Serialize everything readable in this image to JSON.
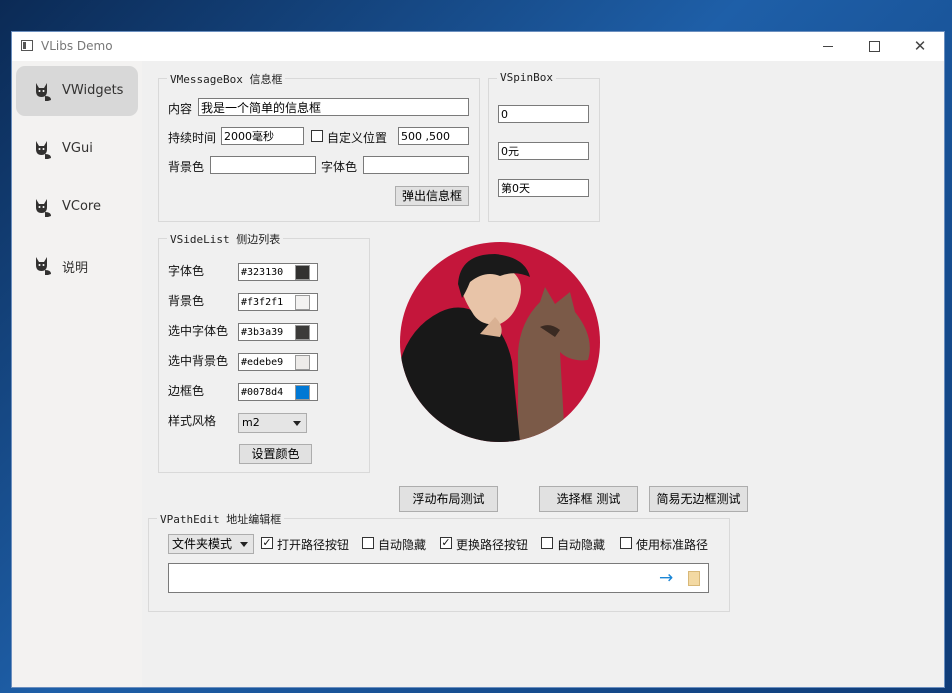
{
  "window": {
    "title": "VLibs Demo"
  },
  "sidebar": {
    "items": [
      {
        "label": "VWidgets",
        "active": true
      },
      {
        "label": "VGui"
      },
      {
        "label": "VCore"
      },
      {
        "label": "说明"
      }
    ]
  },
  "message_box": {
    "title": "VMessageBox 信息框",
    "content_label": "内容",
    "content_value": "我是一个简单的信息框",
    "duration_label": "持续时间",
    "duration_value": "2000毫秒",
    "custom_pos_label": "自定义位置",
    "custom_pos_checked": false,
    "position_value": "500 ,500",
    "bg_label": "背景色",
    "bg_value": "",
    "font_label": "字体色",
    "font_value": "",
    "popup_button": "弹出信息框"
  },
  "spin_box": {
    "title": "VSpinBox",
    "values": [
      "0",
      "0元",
      "第0天"
    ]
  },
  "side_list": {
    "title": "VSideList 侧边列表",
    "rows": [
      {
        "label": "字体色",
        "value": "#323130",
        "color": "#323130"
      },
      {
        "label": "背景色",
        "value": "#f3f2f1",
        "color": "#f3f2f1"
      },
      {
        "label": "选中字体色",
        "value": "#3b3a39",
        "color": "#3b3a39"
      },
      {
        "label": "选中背景色",
        "value": "#edebe9",
        "color": "#edebe9"
      },
      {
        "label": "边框色",
        "value": "#0078d4",
        "color": "#0078d4"
      }
    ],
    "style_label": "样式风格",
    "style_value": "m2",
    "set_button": "设置颜色"
  },
  "buttons": {
    "float_layout": "浮动布局测试",
    "select_box": "选择框 测试",
    "frameless": "简易无边框测试"
  },
  "path_edit": {
    "title": "VPathEdit 地址编辑框",
    "mode_value": "文件夹模式",
    "options": [
      {
        "label": "打开路径按钮",
        "checked": true
      },
      {
        "label": "自动隐藏",
        "checked": false
      },
      {
        "label": "更换路径按钮",
        "checked": true
      },
      {
        "label": "自动隐藏",
        "checked": false
      },
      {
        "label": "使用标准路径",
        "checked": false
      }
    ],
    "path_value": ""
  },
  "colors": {
    "arrow": "#1b86d6",
    "folder": "#f3d9a3",
    "avatar_bg": "#c4163b"
  }
}
